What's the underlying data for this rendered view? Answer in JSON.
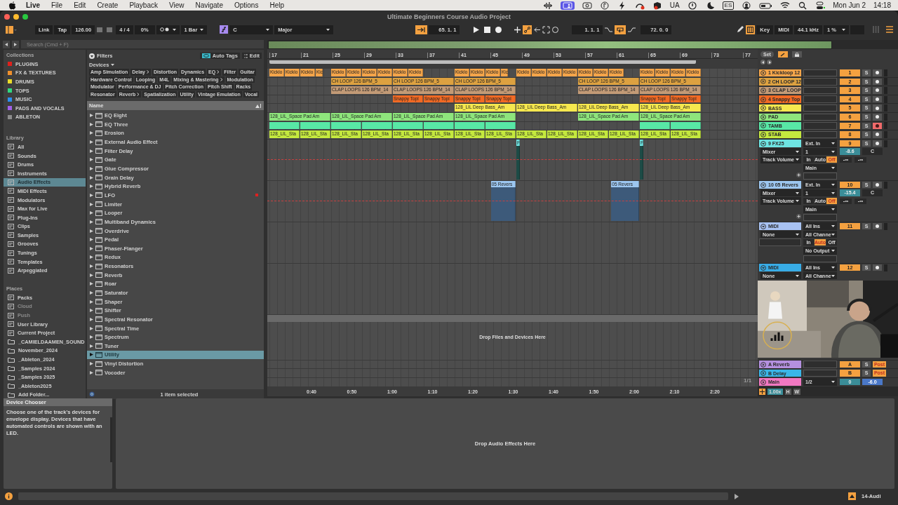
{
  "menubar": {
    "app": "Live",
    "menus": [
      "File",
      "Edit",
      "Create",
      "Playback",
      "View",
      "Navigate",
      "Options",
      "Help"
    ],
    "status_items": [
      {
        "kind": "waveform"
      },
      {
        "kind": "screen"
      },
      {
        "kind": "camera"
      },
      {
        "kind": "note"
      },
      {
        "kind": "bolt"
      },
      {
        "kind": "gauge"
      },
      {
        "kind": "box"
      },
      {
        "kind": "text",
        "label": "UA"
      },
      {
        "kind": "alert"
      },
      {
        "kind": "moon"
      },
      {
        "kind": "boxed",
        "label": "ES"
      },
      {
        "kind": "user"
      },
      {
        "kind": "battery"
      },
      {
        "kind": "wifi"
      },
      {
        "kind": "search"
      },
      {
        "kind": "toggles"
      }
    ],
    "date": "Mon Jun 2",
    "time": "14:18"
  },
  "window": {
    "title": "Ultimate Beginners Course Audio Project"
  },
  "control_bar": {
    "link": "Link",
    "tap": "Tap",
    "tempo": "126.00",
    "signature": "4 / 4",
    "groove": "0%",
    "quantize": "1 Bar",
    "key": "C",
    "scale": "Major",
    "back_to_arrangement": true,
    "position": "65. 1. 1",
    "automation_arm": true,
    "loop_start": "1. 1. 1",
    "loop": true,
    "loop_length": "72. 0. 0",
    "computer_keyboard": true,
    "key_map": "Key",
    "midi_map": "MIDI",
    "sample_rate": "44.1 kHz",
    "cpu": "1 %"
  },
  "browser": {
    "search": {
      "placeholder": "Search (Cmd + F)"
    },
    "collections_title": "Collections",
    "collections": [
      {
        "label": "PLUGINS",
        "color": "#e0201c"
      },
      {
        "label": "FX & TEXTURES",
        "color": "#f0902c"
      },
      {
        "label": "DRUMS",
        "color": "#eadc2a"
      },
      {
        "label": "TOPS",
        "color": "#30d880"
      },
      {
        "label": "MUSIC",
        "color": "#2c8ff0"
      },
      {
        "label": "PADS AND VOCALS",
        "color": "#a060e8"
      },
      {
        "label": "ABLETON",
        "color": "#8c8c8c"
      }
    ],
    "library_title": "Library",
    "library": [
      {
        "label": "All",
        "selected": false
      },
      {
        "label": "Sounds",
        "selected": false
      },
      {
        "label": "Drums",
        "selected": false
      },
      {
        "label": "Instruments",
        "selected": false
      },
      {
        "label": "Audio Effects",
        "selected": true
      },
      {
        "label": "MIDI Effects",
        "selected": false
      },
      {
        "label": "Modulators",
        "selected": false
      },
      {
        "label": "Max for Live",
        "selected": false
      },
      {
        "label": "Plug-Ins",
        "selected": false
      },
      {
        "label": "Clips",
        "selected": false
      },
      {
        "label": "Samples",
        "selected": false
      },
      {
        "label": "Grooves",
        "selected": false
      },
      {
        "label": "Tunings",
        "selected": false
      },
      {
        "label": "Templates",
        "selected": false
      },
      {
        "label": "Arpeggiated",
        "selected": false
      }
    ],
    "places_title": "Places",
    "places": [
      {
        "label": "Packs",
        "kind": "place",
        "disabled": false
      },
      {
        "label": "Cloud",
        "kind": "place",
        "disabled": true
      },
      {
        "label": "Push",
        "kind": "place",
        "disabled": true
      },
      {
        "label": "User Library",
        "kind": "place",
        "disabled": false
      },
      {
        "label": "Current Project",
        "kind": "place",
        "disabled": false
      },
      {
        "label": "_CAMIELDAAMEN_SOUND",
        "kind": "folder",
        "disabled": false
      },
      {
        "label": "November_2024",
        "kind": "folder",
        "disabled": false
      },
      {
        "label": "_Ableton_2024",
        "kind": "folder",
        "disabled": false
      },
      {
        "label": "_Samples 2024",
        "kind": "folder",
        "disabled": false
      },
      {
        "label": "_Samples 2025",
        "kind": "folder",
        "disabled": false
      },
      {
        "label": "_Ableton2025",
        "kind": "folder",
        "disabled": false
      },
      {
        "label": "Add Folder...",
        "kind": "folder",
        "disabled": false
      }
    ],
    "filters": {
      "label": "Filters",
      "auto_tags": "Auto Tags",
      "edit": "Edit",
      "category": "Devices",
      "tags": [
        {
          "label": "Amp Simulation",
          "submenu": false
        },
        {
          "label": "Delay",
          "submenu": true
        },
        {
          "label": "Distortion",
          "submenu": false
        },
        {
          "label": "Dynamics",
          "submenu": false
        },
        {
          "label": "EQ",
          "submenu": true
        },
        {
          "label": "Filter",
          "submenu": false
        },
        {
          "label": "Guitar",
          "submenu": false
        },
        {
          "label": "Hardware Control",
          "submenu": false
        },
        {
          "label": "Looping",
          "submenu": false
        },
        {
          "label": "M4L",
          "submenu": false
        },
        {
          "label": "Mixing & Mastering",
          "submenu": true
        },
        {
          "label": "Modulation",
          "submenu": false
        },
        {
          "label": "Modulator",
          "submenu": false
        },
        {
          "label": "Performance & DJ",
          "submenu": false
        },
        {
          "label": "Pitch Correction",
          "submenu": false
        },
        {
          "label": "Pitch Shift",
          "submenu": false
        },
        {
          "label": "Racks",
          "submenu": false
        },
        {
          "label": "Resonator",
          "submenu": false
        },
        {
          "label": "Reverb",
          "submenu": true
        },
        {
          "label": "Spatialization",
          "submenu": false
        },
        {
          "label": "Utility",
          "submenu": false
        },
        {
          "label": "Vintage Emulation",
          "submenu": false
        },
        {
          "label": "Vocal",
          "submenu": false
        }
      ]
    },
    "list": {
      "column": "Name",
      "items": [
        {
          "label": "EQ Eight",
          "selected": false,
          "alert": false
        },
        {
          "label": "EQ Three",
          "selected": false,
          "alert": false
        },
        {
          "label": "Erosion",
          "selected": false,
          "alert": false
        },
        {
          "label": "External Audio Effect",
          "selected": false,
          "alert": false
        },
        {
          "label": "Filter Delay",
          "selected": false,
          "alert": false
        },
        {
          "label": "Gate",
          "selected": false,
          "alert": false
        },
        {
          "label": "Glue Compressor",
          "selected": false,
          "alert": false
        },
        {
          "label": "Grain Delay",
          "selected": false,
          "alert": false
        },
        {
          "label": "Hybrid Reverb",
          "selected": false,
          "alert": false
        },
        {
          "label": "LFO",
          "selected": false,
          "alert": true
        },
        {
          "label": "Limiter",
          "selected": false,
          "alert": false
        },
        {
          "label": "Looper",
          "selected": false,
          "alert": false
        },
        {
          "label": "Multiband Dynamics",
          "selected": false,
          "alert": false
        },
        {
          "label": "Overdrive",
          "selected": false,
          "alert": false
        },
        {
          "label": "Pedal",
          "selected": false,
          "alert": false
        },
        {
          "label": "Phaser-Flanger",
          "selected": false,
          "alert": false
        },
        {
          "label": "Redux",
          "selected": false,
          "alert": false
        },
        {
          "label": "Resonators",
          "selected": false,
          "alert": false
        },
        {
          "label": "Reverb",
          "selected": false,
          "alert": false
        },
        {
          "label": "Roar",
          "selected": false,
          "alert": false
        },
        {
          "label": "Saturator",
          "selected": false,
          "alert": false
        },
        {
          "label": "Shaper",
          "selected": false,
          "alert": false
        },
        {
          "label": "Shifter",
          "selected": false,
          "alert": false
        },
        {
          "label": "Spectral Resonator",
          "selected": false,
          "alert": false
        },
        {
          "label": "Spectral Time",
          "selected": false,
          "alert": false
        },
        {
          "label": "Spectrum",
          "selected": false,
          "alert": false
        },
        {
          "label": "Tuner",
          "selected": false,
          "alert": false
        },
        {
          "label": "Utility",
          "selected": true,
          "alert": false
        },
        {
          "label": "Vinyl Distortion",
          "selected": false,
          "alert": false
        },
        {
          "label": "Vocoder",
          "selected": false,
          "alert": false
        }
      ],
      "status": "1 item selected"
    }
  },
  "arrangement": {
    "bars": [
      "17",
      "21",
      "25",
      "29",
      "33",
      "37",
      "41",
      "45",
      "49",
      "53",
      "57",
      "61",
      "65",
      "69",
      "73",
      "77"
    ],
    "set": "Set",
    "tracks": [
      {
        "name": "1 Kickloop 12",
        "color": "#f5a54a",
        "expanded": false,
        "automation": false,
        "number": "1",
        "active": true,
        "solo": "S",
        "armed": false,
        "clips": [
          {
            "name": "Kicklo"
          },
          {
            "name": "Kicklo"
          },
          {
            "name": "Kicklo"
          },
          {
            "name": "Kic"
          },
          {
            "name": "Kicklo"
          },
          {
            "name": "Kicklo"
          },
          {
            "name": "Kicklo"
          },
          {
            "name": "Kicklo"
          },
          {
            "name": "Kicklo"
          },
          {
            "name": "Kicklo"
          },
          {
            "name": "Kicklo"
          },
          {
            "name": "Kicklo"
          },
          {
            "name": "Kicklo"
          },
          {
            "name": "Kic"
          },
          {
            "name": "Kicklo"
          },
          {
            "name": "Kicklo"
          },
          {
            "name": "Kicklo"
          },
          {
            "name": "Kicklo"
          },
          {
            "name": "Kicklo"
          },
          {
            "name": "Kicklo"
          },
          {
            "name": "Kicklo"
          },
          {
            "name": "Kicklo"
          },
          {
            "name": "Kicklo"
          },
          {
            "name": "Kicklo"
          },
          {
            "name": "Kicklo"
          }
        ]
      },
      {
        "name": "2 CH LOOP 12",
        "color": "#dda140",
        "expanded": false,
        "automation": false,
        "number": "2",
        "active": true,
        "solo": "S",
        "armed": false,
        "clips": [
          {
            "name": "CH LOOP 126 BPM_5"
          },
          {
            "name": "CH LOOP 126 BPM_5"
          },
          {
            "name": "CH LOOP 126 BPM_5"
          },
          {
            "name": "CH LOOP 126 BPM_5"
          },
          {
            "name": "CH LOOP 126 BPM_5"
          }
        ]
      },
      {
        "name": "3 CLAP LOOP",
        "color": "#c29a76",
        "expanded": false,
        "automation": false,
        "number": "3",
        "active": true,
        "solo": "S",
        "armed": false,
        "clips": [
          {
            "name": "CLAP LOOPS 126 BPM_14"
          },
          {
            "name": "CLAP LOOPS 126 BPM_14"
          },
          {
            "name": "CLAP LOOPS 126 BPM_14"
          },
          {
            "name": "CLAP LOOPS 126 BPM_14"
          },
          {
            "name": "CLAP LOOPS 126 BPM_14"
          }
        ]
      },
      {
        "name": "4 Snappy Top",
        "color": "#f26a24",
        "expanded": false,
        "automation": false,
        "number": "4",
        "active": true,
        "solo": "S",
        "armed": false,
        "clips": [
          {
            "name": "Snappy Topl"
          },
          {
            "name": "Snappy Topl"
          },
          {
            "name": "Snappy Topl"
          },
          {
            "name": "Snappy Topl"
          },
          {
            "name": "Snappy Topl"
          },
          {
            "name": "Snappy Topl"
          }
        ]
      },
      {
        "name": "BASS",
        "color": "#f6e84e",
        "expanded": false,
        "automation": false,
        "number": "5",
        "active": true,
        "solo": "S",
        "armed": false,
        "clips": [
          {
            "name": "128_LIL Deep Bass_Am"
          },
          {
            "name": "128_LIL Deep Bass_Am"
          },
          {
            "name": "128_LIL Deep Bass_Am"
          },
          {
            "name": "128_LIL Deep Bass_Am"
          }
        ]
      },
      {
        "name": "PAD",
        "color": "#8ee57c",
        "expanded": false,
        "automation": false,
        "number": "6",
        "active": true,
        "solo": "S",
        "armed": false,
        "clips": [
          {
            "name": "128_LIL_Space Pad Am"
          },
          {
            "name": "128_LIL_Space Pad Am"
          },
          {
            "name": "128_LIL_Space Pad Am"
          },
          {
            "name": "128_LIL_Space Pad Am"
          },
          {
            "name": "128_LIL_Space Pad Am"
          },
          {
            "name": "128_LIL_Space Pad Am"
          }
        ]
      },
      {
        "name": "TAMB",
        "color": "#58e8a6",
        "expanded": false,
        "automation": false,
        "number": "7",
        "active": true,
        "solo": "S",
        "armed": true,
        "clips": [
          {
            "selected": false
          },
          {
            "selected": false
          },
          {
            "selected": false
          },
          {
            "selected": false
          },
          {
            "selected": false
          },
          {
            "selected": false
          },
          {
            "selected": false
          },
          {
            "selected": false
          },
          {
            "selected": false
          },
          {
            "selected": false
          }
        ]
      },
      {
        "name": "STAB",
        "color": "#c4e83e",
        "expanded": false,
        "automation": false,
        "number": "8",
        "active": true,
        "solo": "S",
        "armed": false,
        "clips": [
          {
            "name": "128_LIL_Sta"
          },
          {
            "name": "128_LIL_Sta"
          },
          {
            "name": "128_LIL_Sta"
          },
          {
            "name": "128_LIL_Sta"
          },
          {
            "name": "128_LIL_Sta"
          },
          {
            "name": "128_LIL_Sta"
          },
          {
            "name": "128_LIL_Sta"
          },
          {
            "name": "128_LIL_Sta"
          },
          {
            "name": "128_LIL_Sta"
          },
          {
            "name": "128_LIL_Sta"
          },
          {
            "name": "128_LIL_Sta"
          },
          {
            "name": "128_LIL_Sta"
          },
          {
            "name": "128_LIL_Sta"
          },
          {
            "name": "128_LIL_Sta"
          }
        ]
      },
      {
        "name": "9 FX25",
        "color": "#6ee4e2",
        "expanded": true,
        "automation": true,
        "input": "Ext. In",
        "number": "9",
        "active": true,
        "solo": "S",
        "armed": false,
        "device": "Mixer",
        "channel": "1",
        "volume": "-8.6",
        "pan": "C",
        "control": "Track Volume",
        "monitor": [
          {
            "label": "In",
            "selected": false
          },
          {
            "label": "Auto",
            "selected": false
          },
          {
            "label": "Off",
            "selected": true
          }
        ],
        "peaks": [
          "-∞",
          "-∞"
        ],
        "output": "Main",
        "clips": [
          {
            "name": "F"
          },
          {
            "name": "F"
          }
        ]
      },
      {
        "name": "10 05 Revers",
        "color": "#9cc6f0",
        "expanded": true,
        "automation": true,
        "input": "Ext. In",
        "number": "10",
        "active": true,
        "solo": "S",
        "armed": false,
        "device": "Mixer",
        "channel": "1",
        "volume": "-15.4",
        "pan": "C",
        "control": "Track Volume",
        "monitor": [
          {
            "label": "In",
            "selected": false
          },
          {
            "label": "Auto",
            "selected": false
          },
          {
            "label": "Off",
            "selected": true
          }
        ],
        "peaks": [
          "-∞",
          "-∞"
        ],
        "output": "Main",
        "clips": [
          {
            "name": "05 Revers"
          },
          {
            "name": "05 Revers"
          }
        ]
      },
      {
        "name": "MIDI",
        "color": "#a8c2f2",
        "expanded": true,
        "automation": false,
        "input": "All Ins",
        "number": "11",
        "active": true,
        "solo": "S",
        "armed": false,
        "device": "None",
        "channel": "All Channe",
        "monitor": [
          {
            "label": "In",
            "selected": false
          },
          {
            "label": "Auto",
            "selected": true
          },
          {
            "label": "Off",
            "selected": false
          }
        ],
        "output": "No Output"
      },
      {
        "name": "MIDI",
        "color": "#38ace6",
        "expanded": true,
        "automation": false,
        "input": "All Ins",
        "number": "12",
        "active": true,
        "solo": "S",
        "armed": false,
        "device": "None",
        "channel": "All Channe"
      }
    ],
    "drop_hint": "Drop Files and Devices Here",
    "page": "1/1",
    "returns": [
      {
        "kind": "return",
        "name": "A Reverb",
        "color": "#b490e0",
        "number": "A",
        "solo": "S",
        "send_mode": "Post"
      },
      {
        "kind": "return",
        "name": "B Delay",
        "color": "#3ab6e8",
        "number": "B",
        "solo": "S",
        "send_mode": "Post"
      },
      {
        "kind": "main",
        "name": "Main",
        "color": "#f278c2",
        "output": "1/2",
        "cue": "0",
        "volume": "-6.0"
      }
    ],
    "times": [
      "0:40",
      "0:50",
      "1:00",
      "1:10",
      "1:20",
      "1:30",
      "1:40",
      "1:50",
      "2:00",
      "2:10",
      "2:20"
    ],
    "zoom": "1.00x",
    "h": "H",
    "w": "W",
    "webcam": {
      "kind": "picture"
    }
  },
  "detail": {
    "title": "Device Chooser",
    "text": "Choose one of the track's devices for envelope display. Devices that have automated controls are shown with an LED.",
    "drop_hint": "Drop Audio Effects Here"
  },
  "status_bar": {
    "track": "14-Audi"
  }
}
